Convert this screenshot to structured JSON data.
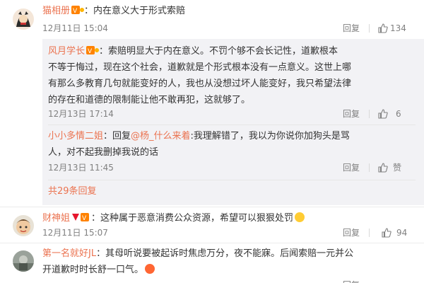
{
  "comments": [
    {
      "user": "猫相册",
      "text": "：内在意义大于形式索赔",
      "time": "12月11日 15:04",
      "reply_label": "回复",
      "likes": "134"
    },
    {
      "user": "财神姐",
      "text_line1": "：这种属于恶意消费公众资源，希望可以狠狠处罚",
      "time": "12月11日 15:07",
      "reply_label": "回复",
      "likes": "94"
    },
    {
      "user": "第一名就好JL",
      "text_line1": "：其母听说要被起诉时焦虑万分，夜不能寐。后闻索赔一元并公",
      "text_line2": "开道歉时时长舒一口气。",
      "reply_label": "回复",
      "likes": "",
      "time": ""
    }
  ],
  "replies": [
    {
      "user": "风月学长",
      "line1": "：索赔明显大于内在意义。不罚个够不会长记性，道歉根本",
      "line2": "不等于悔过，现在这个社会，道歉就是个形式根本没有一点意义。这世上哪",
      "line3": "有那么多教育几句就能变好的人，我也从没想过坏人能变好，我只希望法律",
      "line4": "的存在和道德的限制能让他不敢再犯，这就够了。",
      "time": "12月13日 17:14",
      "reply_label": "回复",
      "likes": "6"
    },
    {
      "user": "小小多情二姐",
      "prefix": "：回复",
      "mention": "@杨_什么来着",
      "line1_rest": ":我理解错了，我以为你说你加狗头是骂",
      "line2": "人，对不起我删掉我说的话",
      "time": "12月13日 11:45",
      "reply_label": "回复",
      "likes": "赞"
    }
  ],
  "more_replies": "共29条回复",
  "colors": {
    "username": "#eb7350",
    "meta": "#808080",
    "reply_bg": "#f2f2f5",
    "text": "#333333"
  }
}
